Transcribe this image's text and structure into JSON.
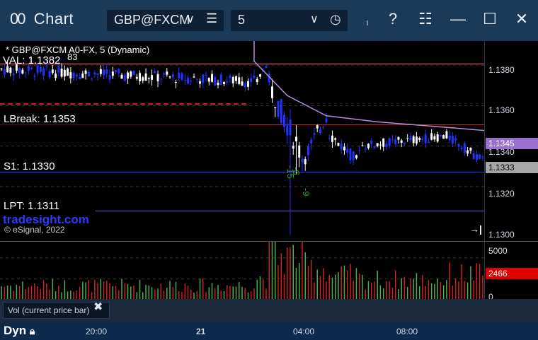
{
  "header": {
    "title": "Chart",
    "symbol_value": "GBP@FXCM",
    "interval_value": "5"
  },
  "legend": {
    "symbol_line": "* GBP@FXCM A0-FX, 5 (Dynamic)",
    "val_label": "VAL: 1.1382",
    "val_overlap": "83",
    "lbreak_label": "LBreak: 1.1353",
    "s1_label": "S1: 1.1330",
    "lpt_label": "LPT: 1.1311",
    "brand": "tradesight.com",
    "copyright": "© eSignal, 2022",
    "annotations": [
      "-15",
      "-6",
      "-9"
    ]
  },
  "price_axis": {
    "ticks": [
      "1.1380",
      "1.1360",
      "1.1340",
      "1.1320",
      "1.1300"
    ],
    "current_price": "1.1333",
    "vwap_price": "1.1345"
  },
  "volume_axis": {
    "ticks": [
      "5000",
      "0"
    ],
    "current_volume": "2466"
  },
  "study": {
    "label": "Vol (current price bar)"
  },
  "time_axis": {
    "ticks": [
      "20:00",
      "21",
      "04:00",
      "08:00"
    ],
    "dyn_label": "Dyn"
  },
  "colors": {
    "up_candle": "#ffffff",
    "down_candle": "#2233ff",
    "vwap": "#b38fd9",
    "resistance_line": "#cc2222",
    "support_line": "#2233ff",
    "volume_up": "#4caf50",
    "volume_down": "#cc2222",
    "current_price_box": "#a6a6a6",
    "vwap_box": "#9b6fd0",
    "volume_box": "#e00000"
  },
  "chart_data": {
    "type": "candlestick",
    "interval_minutes": 5,
    "y_range": [
      1.1293,
      1.1392
    ],
    "volume_range": [
      0,
      6900
    ],
    "levels": [
      {
        "name": "VAL",
        "value": 1.1382
      },
      {
        "name": "LBreak",
        "value": 1.1353
      },
      {
        "name": "S1",
        "value": 1.133
      },
      {
        "name": "LPT",
        "value": 1.1311
      }
    ],
    "price_segments": [
      {
        "bars": 85,
        "start": 1.1378,
        "end": 1.1372,
        "amp": 0.0006,
        "vol": 1700
      },
      {
        "bars": 4,
        "start": 1.1372,
        "end": 1.138,
        "amp": 0.0003,
        "vol": 2600
      },
      {
        "bars": 12,
        "start": 1.137,
        "end": 1.1335,
        "amp": 0.0012,
        "vol": 5200
      },
      {
        "bars": 8,
        "start": 1.1335,
        "end": 1.1355,
        "amp": 0.0008,
        "vol": 3800
      },
      {
        "bars": 10,
        "start": 1.1346,
        "end": 1.1333,
        "amp": 0.0006,
        "vol": 2900
      },
      {
        "bars": 30,
        "start": 1.134,
        "end": 1.1345,
        "amp": 0.0005,
        "vol": 2400
      },
      {
        "bars": 12,
        "start": 1.1344,
        "end": 1.1333,
        "amp": 0.0005,
        "vol": 3000
      }
    ],
    "vwap_points": [
      [
        84,
        1.1392
      ],
      [
        84,
        1.1382
      ],
      [
        95,
        1.1365
      ],
      [
        108,
        1.1355
      ],
      [
        125,
        1.1352
      ],
      [
        150,
        1.1349
      ],
      [
        174,
        1.1346
      ]
    ]
  }
}
